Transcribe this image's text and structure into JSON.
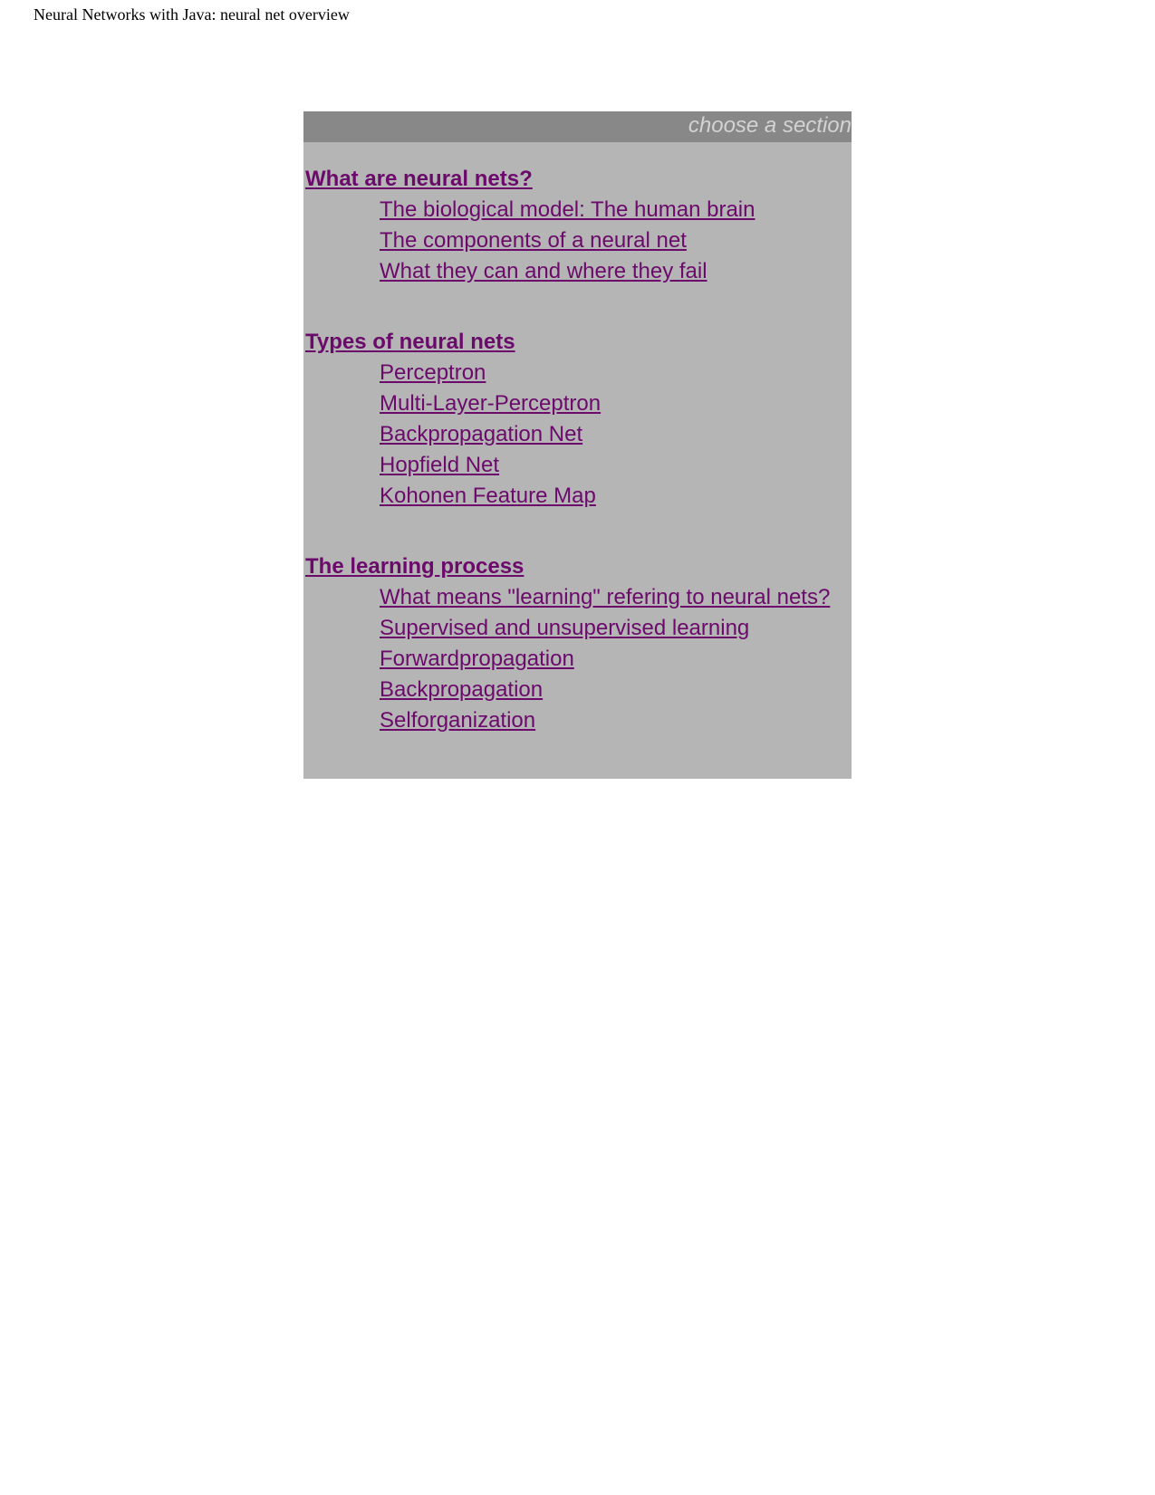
{
  "page": {
    "title": "Neural Networks with Java: neural net overview"
  },
  "panel": {
    "header": "choose a section",
    "colors": {
      "background": "#b5b5b5",
      "header_background": "#888888",
      "header_text": "#d3d3d3",
      "link": "#6b0a6b"
    },
    "sections": [
      {
        "heading": "What are neural nets?",
        "items": [
          "The biological model: The human brain",
          "The components of a neural net",
          "What they can and where they fail"
        ]
      },
      {
        "heading": "Types of neural nets",
        "items": [
          "Perceptron",
          "Multi-Layer-Perceptron",
          "Backpropagation Net",
          "Hopfield Net",
          "Kohonen Feature Map"
        ]
      },
      {
        "heading": "The learning process",
        "items": [
          "What means \"learning\" refering to neural nets?",
          "Supervised and unsupervised learning",
          "Forwardpropagation",
          "Backpropagation",
          "Selforganization"
        ]
      }
    ]
  }
}
